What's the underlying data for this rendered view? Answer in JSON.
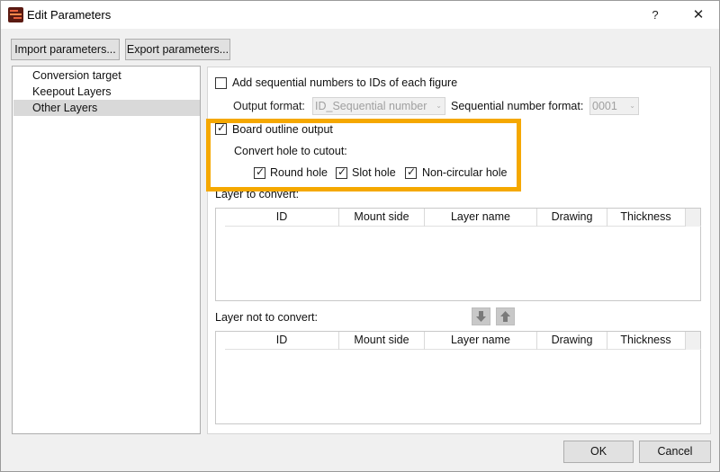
{
  "window": {
    "title": "Edit Parameters",
    "help": "?",
    "close": "✕"
  },
  "top_buttons": {
    "import": "Import parameters...",
    "export": "Export parameters..."
  },
  "nav": {
    "items": [
      "Conversion target",
      "Keepout Layers",
      "Other Layers"
    ],
    "selected": "Other Layers"
  },
  "panel": {
    "add_seq_label": "Add sequential numbers to IDs of each figure",
    "add_seq_checked": false,
    "output_format_label": "Output format:",
    "output_format_value": "ID_Sequential number",
    "seq_format_label": "Sequential number format:",
    "seq_format_value": "0001",
    "board_outline_label": "Board outline output",
    "board_outline_checked": true,
    "convert_hole_label": "Convert hole to cutout:",
    "round_hole_label": "Round hole",
    "slot_hole_label": "Slot hole",
    "noncircular_hole_label": "Non-circular hole",
    "layer_to_convert_label": "Layer to convert:",
    "layer_not_to_convert_label": "Layer not to convert:",
    "columns": [
      "ID",
      "Mount side",
      "Layer name",
      "Drawing",
      "Thickness"
    ],
    "highlight_color": "#f5a800"
  },
  "footer": {
    "ok": "OK",
    "cancel": "Cancel"
  }
}
